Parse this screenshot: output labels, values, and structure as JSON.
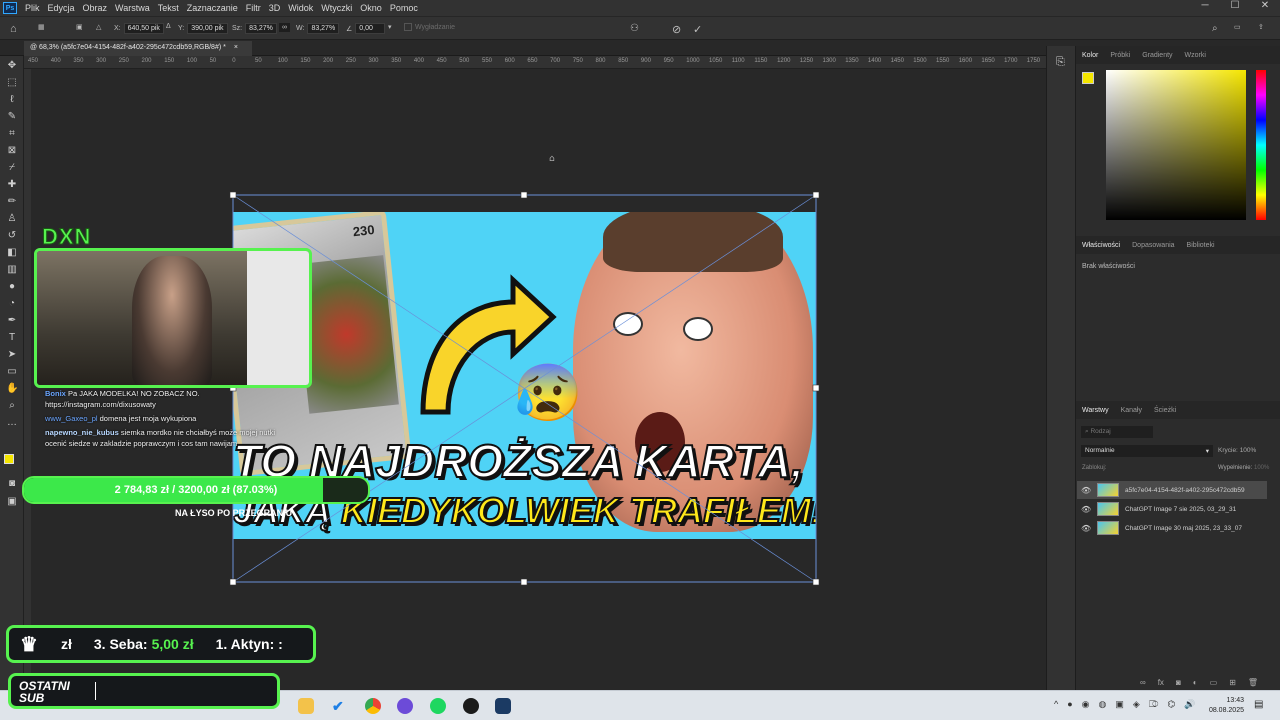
{
  "menu": [
    "Plik",
    "Edycja",
    "Obraz",
    "Warstwa",
    "Tekst",
    "Zaznaczanie",
    "Filtr",
    "3D",
    "Widok",
    "Wtyczki",
    "Okno",
    "Pomoc"
  ],
  "app_logo": "Ps",
  "options": {
    "x_label": "X:",
    "x_value": "640,50 pik",
    "y_label": "Y:",
    "y_value": "390,00 pik",
    "w_label": "Sz:",
    "w_value": "83,27%",
    "h_label": "W:",
    "h_value": "83,27%",
    "angle_value": "0,00",
    "smooth_label": "Wygładzanie"
  },
  "document_tab": "@ 68,3% (a5fc7e04-4154-482f-a402-295c472cdb59,RGB/8#) *",
  "ruler_ticks": [
    "450",
    "400",
    "350",
    "300",
    "250",
    "200",
    "150",
    "100",
    "50",
    "0",
    "50",
    "100",
    "150",
    "200",
    "250",
    "300",
    "350",
    "400",
    "450",
    "500",
    "550",
    "600",
    "650",
    "700",
    "750",
    "800",
    "850",
    "900",
    "950",
    "1000",
    "1050",
    "1100",
    "1150",
    "1200",
    "1250",
    "1300",
    "1350",
    "1400",
    "1450",
    "1500",
    "1550",
    "1600",
    "1650",
    "1700",
    "1750"
  ],
  "thumbnail": {
    "card_hp": "230",
    "title_line1": "TO NAJDROŻSZA KARTA,",
    "title_line2_prefix": "JAKĄ ",
    "title_line2_accent": "KIEDYKOLWIEK TRAFIŁEM!",
    "emoji": "😰"
  },
  "stream": {
    "brand": "DXN",
    "chat": [
      {
        "user": "Bonix",
        "text": "Pa JAKA MODELKA! NO ZOBACZ NO."
      },
      {
        "user": "",
        "text": "https://instagram.com/dixusowaty"
      },
      {
        "user": "www_Gaxeo_pl",
        "text": "domena jest moja wykupiona"
      },
      {
        "user": "napewno_nie_kubus",
        "text": "siemka mordko nie chciałbyś może mojej nutki ocenić siedze w zakladzie poprawczym i cos tam nawijam"
      }
    ],
    "goal": "2 784,83 zł  /  3200,00 zł (87.03%)",
    "goal_fraction": 0.8703,
    "goal_label": "NA ŁYSO PO PRZEGRANIU",
    "leaderboard_prefix": "zł",
    "leaderboard_3": "3. Seba:",
    "leaderboard_3_amount": "5,00 zł",
    "leaderboard_1": "1. Aktyn: :",
    "last_sub_label": "OSTATNI SUB"
  },
  "panels": {
    "color_tabs": [
      "Kolor",
      "Próbki",
      "Gradienty",
      "Wzorki"
    ],
    "props_tabs": [
      "Właściwości",
      "Dopasowania",
      "Biblioteki"
    ],
    "props_empty": "Brak właściwości",
    "layers_tabs": [
      "Warstwy",
      "Kanały",
      "Ścieżki"
    ],
    "layer_search": "Rodzaj",
    "blend_mode": "Normalnie",
    "opacity_label": "Krycie:",
    "opacity_value": "100%",
    "lock_label": "Zablokuj:",
    "fill_label": "Wypełnienie:",
    "fill_value": "100%",
    "layers": [
      "a5fc7e04-4154-482f-a402-295c472cdb59",
      "ChatGPT Image 7 sie 2025, 03_29_31",
      "ChatGPT Image 30 maj 2025, 23_33_07"
    ]
  },
  "taskbar": {
    "time": "13:43",
    "date": "08.08.2025"
  },
  "colors": {
    "accent": "#57f24f",
    "fg_swatch": "#f5e600",
    "thumb_bg": "#4fd3f6",
    "title_yellow": "#ffe81a"
  }
}
